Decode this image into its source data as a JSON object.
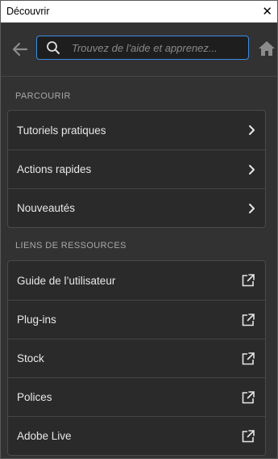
{
  "window": {
    "title": "Découvrir",
    "close_glyph": "✕"
  },
  "search": {
    "placeholder": "Trouvez de l'aide et apprenez...",
    "value": ""
  },
  "icons": {
    "back": "arrow-left-icon",
    "search": "magnifier-icon",
    "home": "home-icon",
    "chevron": "chevron-right-icon",
    "external": "external-link-icon"
  },
  "colors": {
    "accent": "#3e8be6",
    "background": "#323232"
  },
  "browse": {
    "title": "PARCOURIR",
    "items": [
      {
        "label": "Tutoriels pratiques"
      },
      {
        "label": "Actions rapides"
      },
      {
        "label": "Nouveautés"
      }
    ]
  },
  "resources": {
    "title": "LIENS DE RESSOURCES",
    "items": [
      {
        "label": "Guide de l’utilisateur"
      },
      {
        "label": "Plug-ins"
      },
      {
        "label": "Stock"
      },
      {
        "label": "Polices"
      },
      {
        "label": "Adobe Live"
      }
    ]
  }
}
